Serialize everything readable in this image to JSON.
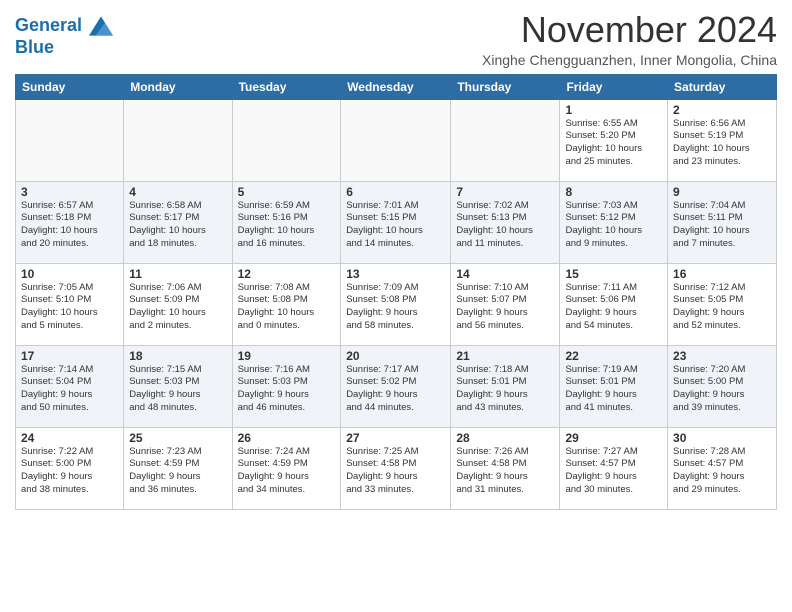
{
  "header": {
    "logo_line1": "General",
    "logo_line2": "Blue",
    "month_year": "November 2024",
    "location": "Xinghe Chengguanzhen, Inner Mongolia, China"
  },
  "weekdays": [
    "Sunday",
    "Monday",
    "Tuesday",
    "Wednesday",
    "Thursday",
    "Friday",
    "Saturday"
  ],
  "weeks": [
    [
      {
        "day": "",
        "info": ""
      },
      {
        "day": "",
        "info": ""
      },
      {
        "day": "",
        "info": ""
      },
      {
        "day": "",
        "info": ""
      },
      {
        "day": "",
        "info": ""
      },
      {
        "day": "1",
        "info": "Sunrise: 6:55 AM\nSunset: 5:20 PM\nDaylight: 10 hours\nand 25 minutes."
      },
      {
        "day": "2",
        "info": "Sunrise: 6:56 AM\nSunset: 5:19 PM\nDaylight: 10 hours\nand 23 minutes."
      }
    ],
    [
      {
        "day": "3",
        "info": "Sunrise: 6:57 AM\nSunset: 5:18 PM\nDaylight: 10 hours\nand 20 minutes."
      },
      {
        "day": "4",
        "info": "Sunrise: 6:58 AM\nSunset: 5:17 PM\nDaylight: 10 hours\nand 18 minutes."
      },
      {
        "day": "5",
        "info": "Sunrise: 6:59 AM\nSunset: 5:16 PM\nDaylight: 10 hours\nand 16 minutes."
      },
      {
        "day": "6",
        "info": "Sunrise: 7:01 AM\nSunset: 5:15 PM\nDaylight: 10 hours\nand 14 minutes."
      },
      {
        "day": "7",
        "info": "Sunrise: 7:02 AM\nSunset: 5:13 PM\nDaylight: 10 hours\nand 11 minutes."
      },
      {
        "day": "8",
        "info": "Sunrise: 7:03 AM\nSunset: 5:12 PM\nDaylight: 10 hours\nand 9 minutes."
      },
      {
        "day": "9",
        "info": "Sunrise: 7:04 AM\nSunset: 5:11 PM\nDaylight: 10 hours\nand 7 minutes."
      }
    ],
    [
      {
        "day": "10",
        "info": "Sunrise: 7:05 AM\nSunset: 5:10 PM\nDaylight: 10 hours\nand 5 minutes."
      },
      {
        "day": "11",
        "info": "Sunrise: 7:06 AM\nSunset: 5:09 PM\nDaylight: 10 hours\nand 2 minutes."
      },
      {
        "day": "12",
        "info": "Sunrise: 7:08 AM\nSunset: 5:08 PM\nDaylight: 10 hours\nand 0 minutes."
      },
      {
        "day": "13",
        "info": "Sunrise: 7:09 AM\nSunset: 5:08 PM\nDaylight: 9 hours\nand 58 minutes."
      },
      {
        "day": "14",
        "info": "Sunrise: 7:10 AM\nSunset: 5:07 PM\nDaylight: 9 hours\nand 56 minutes."
      },
      {
        "day": "15",
        "info": "Sunrise: 7:11 AM\nSunset: 5:06 PM\nDaylight: 9 hours\nand 54 minutes."
      },
      {
        "day": "16",
        "info": "Sunrise: 7:12 AM\nSunset: 5:05 PM\nDaylight: 9 hours\nand 52 minutes."
      }
    ],
    [
      {
        "day": "17",
        "info": "Sunrise: 7:14 AM\nSunset: 5:04 PM\nDaylight: 9 hours\nand 50 minutes."
      },
      {
        "day": "18",
        "info": "Sunrise: 7:15 AM\nSunset: 5:03 PM\nDaylight: 9 hours\nand 48 minutes."
      },
      {
        "day": "19",
        "info": "Sunrise: 7:16 AM\nSunset: 5:03 PM\nDaylight: 9 hours\nand 46 minutes."
      },
      {
        "day": "20",
        "info": "Sunrise: 7:17 AM\nSunset: 5:02 PM\nDaylight: 9 hours\nand 44 minutes."
      },
      {
        "day": "21",
        "info": "Sunrise: 7:18 AM\nSunset: 5:01 PM\nDaylight: 9 hours\nand 43 minutes."
      },
      {
        "day": "22",
        "info": "Sunrise: 7:19 AM\nSunset: 5:01 PM\nDaylight: 9 hours\nand 41 minutes."
      },
      {
        "day": "23",
        "info": "Sunrise: 7:20 AM\nSunset: 5:00 PM\nDaylight: 9 hours\nand 39 minutes."
      }
    ],
    [
      {
        "day": "24",
        "info": "Sunrise: 7:22 AM\nSunset: 5:00 PM\nDaylight: 9 hours\nand 38 minutes."
      },
      {
        "day": "25",
        "info": "Sunrise: 7:23 AM\nSunset: 4:59 PM\nDaylight: 9 hours\nand 36 minutes."
      },
      {
        "day": "26",
        "info": "Sunrise: 7:24 AM\nSunset: 4:59 PM\nDaylight: 9 hours\nand 34 minutes."
      },
      {
        "day": "27",
        "info": "Sunrise: 7:25 AM\nSunset: 4:58 PM\nDaylight: 9 hours\nand 33 minutes."
      },
      {
        "day": "28",
        "info": "Sunrise: 7:26 AM\nSunset: 4:58 PM\nDaylight: 9 hours\nand 31 minutes."
      },
      {
        "day": "29",
        "info": "Sunrise: 7:27 AM\nSunset: 4:57 PM\nDaylight: 9 hours\nand 30 minutes."
      },
      {
        "day": "30",
        "info": "Sunrise: 7:28 AM\nSunset: 4:57 PM\nDaylight: 9 hours\nand 29 minutes."
      }
    ]
  ]
}
